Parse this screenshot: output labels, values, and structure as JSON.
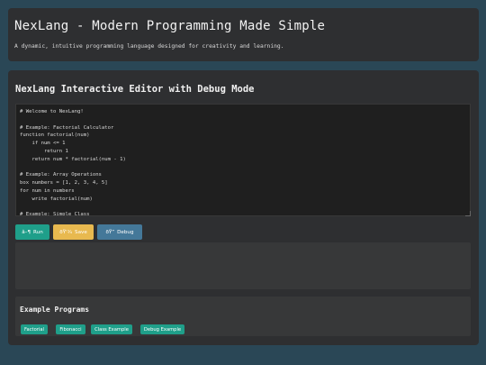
{
  "header": {
    "title": "NexLang - Modern Programming Made Simple",
    "subtitle": "A dynamic, intuitive programming language designed for creativity and learning."
  },
  "editor": {
    "title": "NexLang Interactive Editor with Debug Mode",
    "code": "# Welcome to NexLang!\n\n# Example: Factorial Calculator\nfunction factorial(num)\n    if num <= 1\n        return 1\n    return num * factorial(num - 1)\n\n# Example: Array Operations\nbox numbers = [1, 2, 3, 4, 5]\nfor num in numbers\n    write factorial(num)\n\n# Example: Simple Class"
  },
  "buttons": {
    "run": {
      "icon": "â–¶",
      "label": "Run"
    },
    "save": {
      "icon": "ðŸ'¾",
      "label": "Save"
    },
    "debug": {
      "icon": "ðŸ”",
      "label": "Debug"
    }
  },
  "output": {
    "text": ""
  },
  "examples": {
    "title": "Example Programs",
    "items": [
      "Factorial",
      "Fibonacci",
      "Class Example",
      "Debug Example"
    ]
  }
}
